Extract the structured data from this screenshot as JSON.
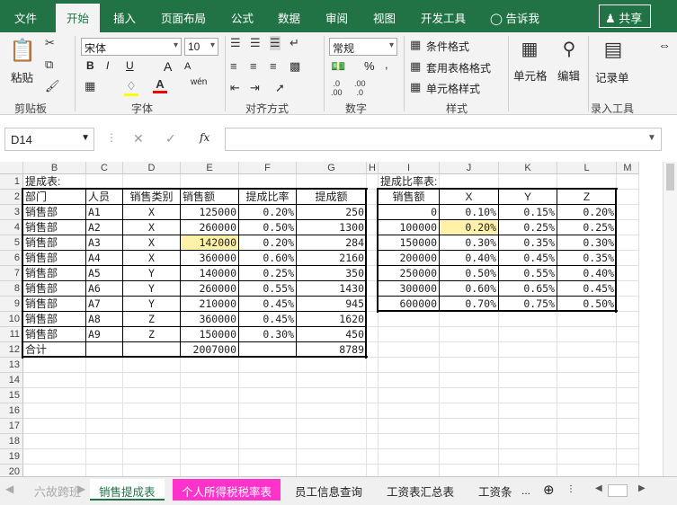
{
  "tabs": [
    "文件",
    "开始",
    "插入",
    "页面布局",
    "公式",
    "数据",
    "审阅",
    "视图",
    "开发工具"
  ],
  "tellme": "告诉我",
  "share": "共享",
  "ribbon": {
    "paste": "粘贴",
    "clipboard": "剪贴板",
    "font_name": "宋体",
    "font_size": "10",
    "font_group": "字体",
    "align_group": "对齐方式",
    "number_format": "常规",
    "number_group": "数字",
    "cond_format": "条件格式",
    "table_format": "套用表格格式",
    "cell_style": "单元格样式",
    "style_group": "样式",
    "cells": "单元格",
    "edit": "编辑",
    "records": "记录单",
    "entry_tools": "录入工具",
    "bold": "B",
    "italic": "I",
    "underline": "U",
    "grow": "A",
    "shrink": "A",
    "wen": "wén",
    "percent": "%",
    "comma": ","
  },
  "formula_bar": {
    "name_box": "D14",
    "fx": "fx",
    "formula": ""
  },
  "columns": [
    "B",
    "C",
    "D",
    "E",
    "F",
    "G",
    "H",
    "I",
    "J",
    "K",
    "L",
    "M"
  ],
  "rows": [
    "1",
    "2",
    "3",
    "4",
    "5",
    "6",
    "7",
    "8",
    "9",
    "10",
    "11",
    "12",
    "13",
    "14",
    "15",
    "16",
    "17",
    "18",
    "19",
    "20"
  ],
  "sheet1": {
    "title": "提成表:",
    "headers": [
      "部门",
      "人员",
      "销售类别",
      "销售额",
      "提成比率",
      "提成额"
    ],
    "data": [
      [
        "销售部",
        "A1",
        "X",
        "125000",
        "0.20%",
        "250"
      ],
      [
        "销售部",
        "A2",
        "X",
        "260000",
        "0.50%",
        "1300"
      ],
      [
        "销售部",
        "A3",
        "X",
        "142000",
        "0.20%",
        "284"
      ],
      [
        "销售部",
        "A4",
        "X",
        "360000",
        "0.60%",
        "2160"
      ],
      [
        "销售部",
        "A5",
        "Y",
        "140000",
        "0.25%",
        "350"
      ],
      [
        "销售部",
        "A6",
        "Y",
        "260000",
        "0.55%",
        "1430"
      ],
      [
        "销售部",
        "A7",
        "Y",
        "210000",
        "0.45%",
        "945"
      ],
      [
        "销售部",
        "A8",
        "Z",
        "360000",
        "0.45%",
        "1620"
      ],
      [
        "销售部",
        "A9",
        "Z",
        "150000",
        "0.30%",
        "450"
      ]
    ],
    "total": [
      "合计",
      "",
      "",
      "2007000",
      "",
      "8789"
    ]
  },
  "sheet2": {
    "title": "提成比率表:",
    "headers": [
      "销售额",
      "X",
      "Y",
      "Z"
    ],
    "data": [
      [
        "0",
        "0.10%",
        "0.15%",
        "0.20%"
      ],
      [
        "100000",
        "0.20%",
        "0.25%",
        "0.25%"
      ],
      [
        "150000",
        "0.30%",
        "0.35%",
        "0.30%"
      ],
      [
        "200000",
        "0.40%",
        "0.45%",
        "0.35%"
      ],
      [
        "250000",
        "0.50%",
        "0.55%",
        "0.40%"
      ],
      [
        "300000",
        "0.60%",
        "0.65%",
        "0.45%"
      ],
      [
        "600000",
        "0.70%",
        "0.75%",
        "0.50%"
      ]
    ]
  },
  "sheet_tabs": [
    "销售提成表",
    "个人所得税税率表",
    "员工信息查询",
    "工资表汇总表",
    "工资条"
  ],
  "more": "...",
  "watermark": "六故跨班",
  "colors": {
    "excel_green": "#217346",
    "highlight": "#fff2a8",
    "tab_pink": "#ff33cc",
    "active_tab_text": "#217346"
  }
}
